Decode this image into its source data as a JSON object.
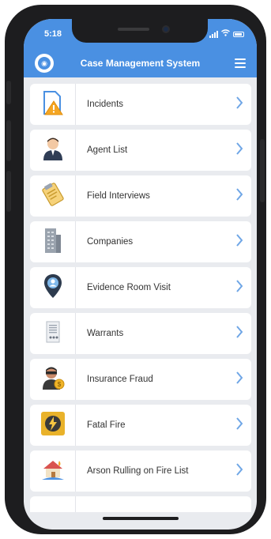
{
  "status_bar": {
    "time": "5:18"
  },
  "header": {
    "title": "Case Management System"
  },
  "colors": {
    "accent": "#4a90e2",
    "chevron": "#6fa6e6",
    "background": "#e9ebef"
  },
  "menu_items": [
    {
      "label": "Incidents",
      "icon": "warning-document-icon"
    },
    {
      "label": "Agent List",
      "icon": "agent-icon"
    },
    {
      "label": "Field Interviews",
      "icon": "clipboard-icon"
    },
    {
      "label": "Companies",
      "icon": "building-icon"
    },
    {
      "label": "Evidence Room Visit",
      "icon": "location-pin-icon"
    },
    {
      "label": "Warrants",
      "icon": "warrant-document-icon"
    },
    {
      "label": "Insurance Fraud",
      "icon": "thief-icon"
    },
    {
      "label": "Fatal Fire",
      "icon": "fire-icon"
    },
    {
      "label": "Arson Rulling on Fire List",
      "icon": "burning-house-icon"
    }
  ]
}
